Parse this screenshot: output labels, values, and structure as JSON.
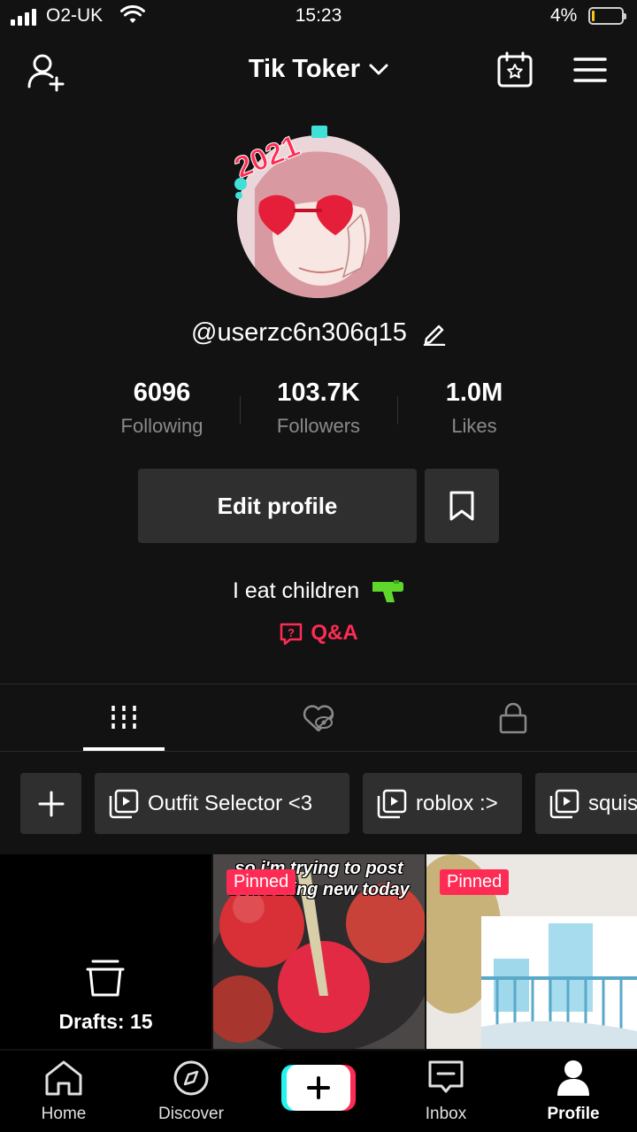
{
  "status_bar": {
    "carrier": "O2-UK",
    "time": "15:23",
    "battery_percent": "4%"
  },
  "header": {
    "title": "Tik Toker"
  },
  "profile": {
    "username": "@userzc6n306q15",
    "bio": "I eat children",
    "qa_label": "Q&A",
    "avatar_badge_text": "2021"
  },
  "stats": [
    {
      "value": "6096",
      "label": "Following"
    },
    {
      "value": "103.7K",
      "label": "Followers"
    },
    {
      "value": "1.0M",
      "label": "Likes"
    }
  ],
  "actions": {
    "edit_profile": "Edit profile"
  },
  "playlists": [
    {
      "label": "Outfit Selector <3"
    },
    {
      "label": "roblox :>"
    },
    {
      "label": "squishmallows"
    }
  ],
  "grid": {
    "drafts_label": "Drafts: 15",
    "videos": [
      {
        "pinned_label": "Pinned",
        "overlay": "so i'm trying to post something new today"
      },
      {
        "pinned_label": "Pinned",
        "overlay": ""
      }
    ]
  },
  "bottom_nav": [
    {
      "label": "Home"
    },
    {
      "label": "Discover"
    },
    {
      "label": "Inbox"
    },
    {
      "label": "Profile"
    }
  ],
  "colors": {
    "background": "#121212",
    "accent": "#fe2c55",
    "cyan": "#25f4ee",
    "button_bg": "#2f2f2f",
    "muted_text": "#8a8a8a"
  }
}
